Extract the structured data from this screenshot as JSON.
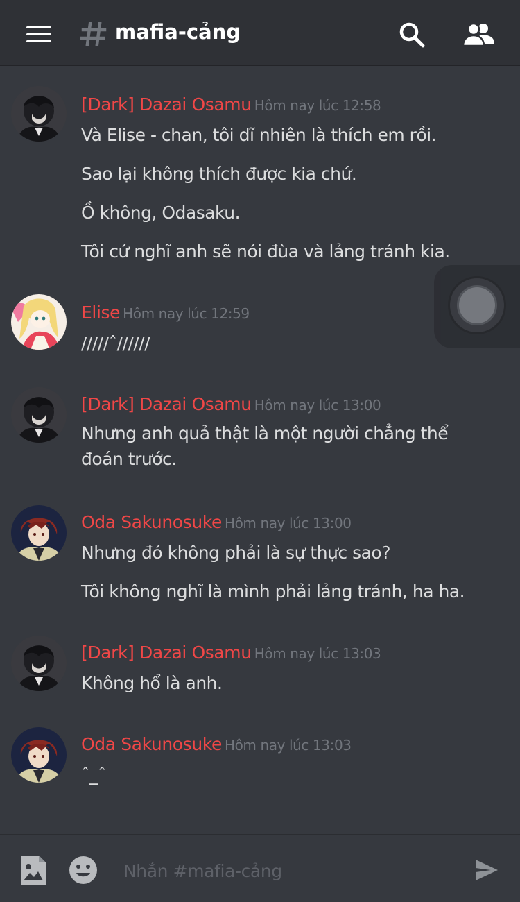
{
  "header": {
    "channel_name": "mafia-cảng",
    "icons": [
      "menu-icon",
      "hash-icon",
      "search-icon",
      "members-icon"
    ]
  },
  "messages": [
    {
      "author": "[Dark] Dazai Osamu",
      "timestamp": "Hôm nay lúc 12:58",
      "avatar": "dazai-avatar",
      "lines": [
        "Và Elise - chan, tôi dĩ nhiên là thích em rồi.",
        "Sao lại không thích được kia chứ.",
        "Ồ không, Odasaku.",
        "Tôi cứ nghĩ anh sẽ nói đùa và lảng tránh kia."
      ]
    },
    {
      "author": "Elise",
      "timestamp": "Hôm nay lúc 12:59",
      "avatar": "elise-avatar",
      "lines": [
        "/////ˆ//////"
      ]
    },
    {
      "author": "[Dark] Dazai Osamu",
      "timestamp": "Hôm nay lúc 13:00",
      "avatar": "dazai-avatar",
      "lines": [
        "Nhưng anh quả thật là một người chẳng thể đoán trước."
      ]
    },
    {
      "author": "Oda Sakunosuke",
      "timestamp": "Hôm nay lúc 13:00",
      "avatar": "oda-avatar",
      "lines": [
        "Nhưng đó không phải là sự thực sao?",
        "Tôi không nghĩ là mình phải lảng tránh, ha ha."
      ]
    },
    {
      "author": "[Dark] Dazai Osamu",
      "timestamp": "Hôm nay lúc 13:03",
      "avatar": "dazai-avatar",
      "lines": [
        "Không hổ là anh."
      ]
    },
    {
      "author": "Oda Sakunosuke",
      "timestamp": "Hôm nay lúc 13:03",
      "avatar": "oda-avatar",
      "lines": [
        "ˆ_ˆ"
      ]
    }
  ],
  "composer": {
    "placeholder": "Nhắn #mafia-cảng",
    "icons": [
      "image-icon",
      "emoji-icon",
      "send-icon"
    ]
  },
  "colors": {
    "background": "#36393f",
    "header": "#2f3136",
    "author": "#f04747",
    "timestamp": "#72767d",
    "text": "#dcddde"
  }
}
